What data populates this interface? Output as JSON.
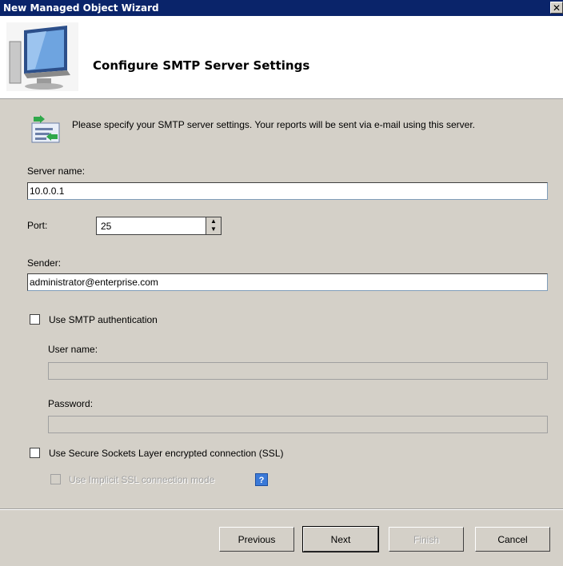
{
  "window": {
    "title": "New Managed Object Wizard",
    "close_glyph": "✕"
  },
  "header": {
    "title": "Configure SMTP Server Settings",
    "icon": "monitor-icon"
  },
  "intro": {
    "icon": "server-settings-icon",
    "text": "Please specify your SMTP server settings. Your reports will be sent via e-mail using this server."
  },
  "form": {
    "server_name_label": "Server name:",
    "server_name_value": "10.0.0.1",
    "port_label": "Port:",
    "port_value": "25",
    "sender_label": "Sender:",
    "sender_value": "administrator@enterprise.com",
    "use_smtp_auth_label": "Use SMTP authentication",
    "use_smtp_auth_checked": false,
    "username_label": "User name:",
    "username_value": "",
    "password_label": "Password:",
    "password_value": "",
    "use_ssl_label": "Use Secure Sockets Layer encrypted connection (SSL)",
    "use_ssl_checked": false,
    "implicit_ssl_label": "Use Implicit SSL connection mode",
    "implicit_ssl_checked": false,
    "help_glyph": "?"
  },
  "buttons": {
    "previous": "Previous",
    "next": "Next",
    "finish": "Finish",
    "cancel": "Cancel"
  }
}
